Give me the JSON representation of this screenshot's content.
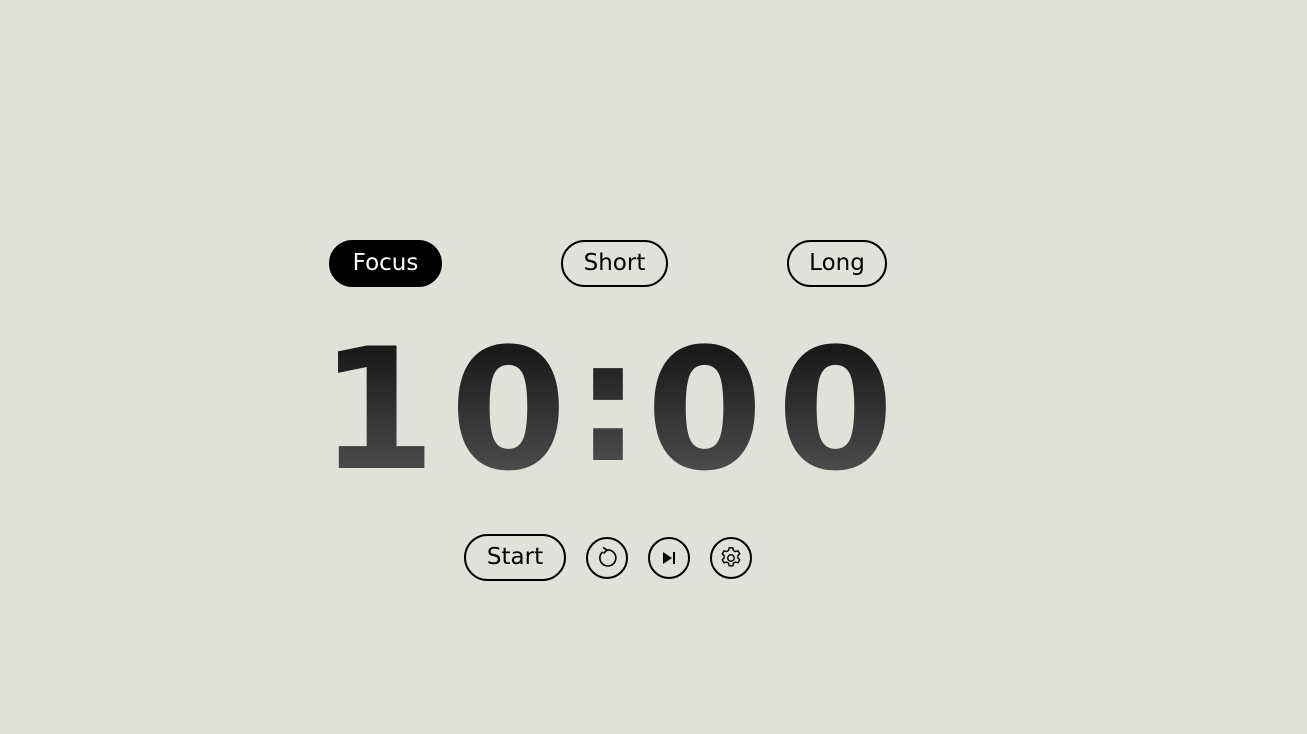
{
  "modes": {
    "focus_label": "Focus",
    "short_label": "Short",
    "long_label": "Long",
    "active": "focus"
  },
  "timer": {
    "minutes": "10",
    "separator": ":",
    "seconds": "00"
  },
  "controls": {
    "start_label": "Start",
    "reset_icon": "reset-icon",
    "skip_icon": "skip-next-icon",
    "settings_icon": "gear-icon"
  },
  "colors": {
    "background": "#e1e1dc",
    "digits_top": "#1a1a1a",
    "digits_bottom": "#5a5a5a"
  }
}
